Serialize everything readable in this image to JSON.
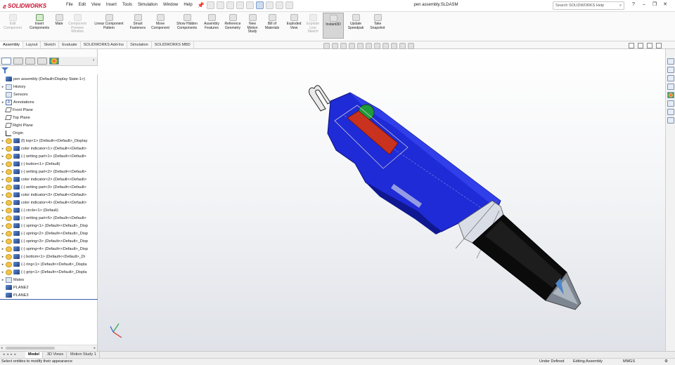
{
  "app": {
    "logo_text": "SOLIDWORKS",
    "document_title": "pen assembly.SLDASM",
    "search_placeholder": "Search SOLIDWORKS Help"
  },
  "menu": [
    "File",
    "Edit",
    "View",
    "Insert",
    "Tools",
    "Simulation",
    "Window",
    "Help"
  ],
  "ribbon": [
    {
      "label": "Edit Component",
      "enabled": false
    },
    {
      "label": "Insert Components",
      "enabled": true
    },
    {
      "label": "Mate",
      "enabled": true
    },
    {
      "label": "Component Preview Window",
      "enabled": false
    },
    {
      "label": "Linear Component Pattern",
      "enabled": true
    },
    {
      "label": "Smart Fasteners",
      "enabled": true
    },
    {
      "label": "Move Component",
      "enabled": true
    },
    {
      "label": "Show Hidden Components",
      "enabled": true
    },
    {
      "label": "Assembly Features",
      "enabled": true
    },
    {
      "label": "Reference Geometry",
      "enabled": true
    },
    {
      "label": "New Motion Study",
      "enabled": true
    },
    {
      "label": "Bill of Materials",
      "enabled": true
    },
    {
      "label": "Exploded View",
      "enabled": true
    },
    {
      "label": "Explode Line Sketch",
      "enabled": false
    },
    {
      "label": "Instant3D",
      "enabled": true,
      "active": true
    },
    {
      "label": "Update Speedpak",
      "enabled": true
    },
    {
      "label": "Take Snapshot",
      "enabled": true
    }
  ],
  "command_tabs": [
    "Assembly",
    "Layout",
    "Sketch",
    "Evaluate",
    "SOLIDWORKS Add-Ins",
    "Simulation",
    "SOLIDWORKS MBD"
  ],
  "active_command_tab": "Assembly",
  "feature_tree": [
    {
      "label": "pen assembly  (Default<Display State-1>)",
      "icon": "assembly",
      "expander": "",
      "indent": 0
    },
    {
      "label": "History",
      "icon": "folder",
      "expander": "▸",
      "indent": 1
    },
    {
      "label": "Sensors",
      "icon": "folder",
      "expander": "",
      "indent": 1
    },
    {
      "label": "Annotations",
      "icon": "annotation",
      "expander": "▸",
      "indent": 1
    },
    {
      "label": "Front Plane",
      "icon": "plane",
      "expander": "",
      "indent": 1
    },
    {
      "label": "Top Plane",
      "icon": "plane",
      "expander": "",
      "indent": 1
    },
    {
      "label": "Right Plane",
      "icon": "plane",
      "expander": "",
      "indent": 1
    },
    {
      "label": "Origin",
      "icon": "origin",
      "expander": "",
      "indent": 1
    },
    {
      "label": "(f) top<1> (Default<<Default>_Display",
      "icon": "component",
      "expander": "▸",
      "indent": 1
    },
    {
      "label": "color indicator<1> (Default<<Default>",
      "icon": "component",
      "expander": "▸",
      "indent": 1
    },
    {
      "label": "(-) writing part<1> (Default<<Default>",
      "icon": "component",
      "expander": "▸",
      "indent": 1
    },
    {
      "label": "(-) button<1> (Default)",
      "icon": "component",
      "expander": "▸",
      "indent": 1
    },
    {
      "label": "(-) writing part<2> (Default<<Default>",
      "icon": "component",
      "expander": "▸",
      "indent": 1
    },
    {
      "label": "color indicator<2> (Default<<Default>",
      "icon": "component",
      "expander": "▸",
      "indent": 1
    },
    {
      "label": "(-) writing part<3> (Default<<Default>",
      "icon": "component",
      "expander": "▸",
      "indent": 1
    },
    {
      "label": "color indicator<3> (Default<<Default>",
      "icon": "component",
      "expander": "▸",
      "indent": 1
    },
    {
      "label": "color indicator<4> (Default<<Default>",
      "icon": "component",
      "expander": "▸",
      "indent": 1
    },
    {
      "label": "(-) circle<1> (Default)",
      "icon": "component",
      "expander": "▸",
      "indent": 1
    },
    {
      "label": "(-) writing part<6> (Default<<Default>",
      "icon": "component",
      "expander": "▸",
      "indent": 1
    },
    {
      "label": "(-) spring<1> (Default<<Default>_Disp",
      "icon": "component",
      "expander": "▸",
      "indent": 1
    },
    {
      "label": "(-) spring<2> (Default<<Default>_Disp",
      "icon": "component",
      "expander": "▸",
      "indent": 1
    },
    {
      "label": "(-) spring<3> (Default<<Default>_Disp",
      "icon": "component",
      "expander": "▸",
      "indent": 1
    },
    {
      "label": "(-) spring<4> (Default<<Default>_Disp",
      "icon": "component",
      "expander": "▸",
      "indent": 1
    },
    {
      "label": "(-) bottom<1> (Default<<Default>_Di",
      "icon": "component",
      "expander": "▸",
      "indent": 1
    },
    {
      "label": "(-) ring<1> (Default<<Default>_Displa",
      "icon": "component",
      "expander": "▸",
      "indent": 1
    },
    {
      "label": "(-) grip<1> (Default<<Default>_Displa",
      "icon": "component",
      "expander": "▸",
      "indent": 1
    },
    {
      "label": "Mates",
      "icon": "folder",
      "expander": "▸",
      "indent": 1
    },
    {
      "label": "PLANE2",
      "icon": "part",
      "expander": "",
      "indent": 1
    },
    {
      "label": "PLANE3",
      "icon": "part",
      "expander": "",
      "indent": 1
    }
  ],
  "bottom_tabs": [
    "Model",
    "3D Views",
    "Motion Study 1"
  ],
  "active_bottom_tab": "Model",
  "status": {
    "message": "Select entities to modify their appearance",
    "definition": "Under Defined",
    "mode": "Editing Assembly",
    "units": "MMGS"
  },
  "colors": {
    "brand_red": "#c8102e",
    "pen_body_blue": "#1f2bd6",
    "pen_grip_black": "#0b0b0b",
    "indicator_green": "#1f9a3a",
    "indicator_red": "#c8321e",
    "tree_separator": "#3a5fa8"
  }
}
